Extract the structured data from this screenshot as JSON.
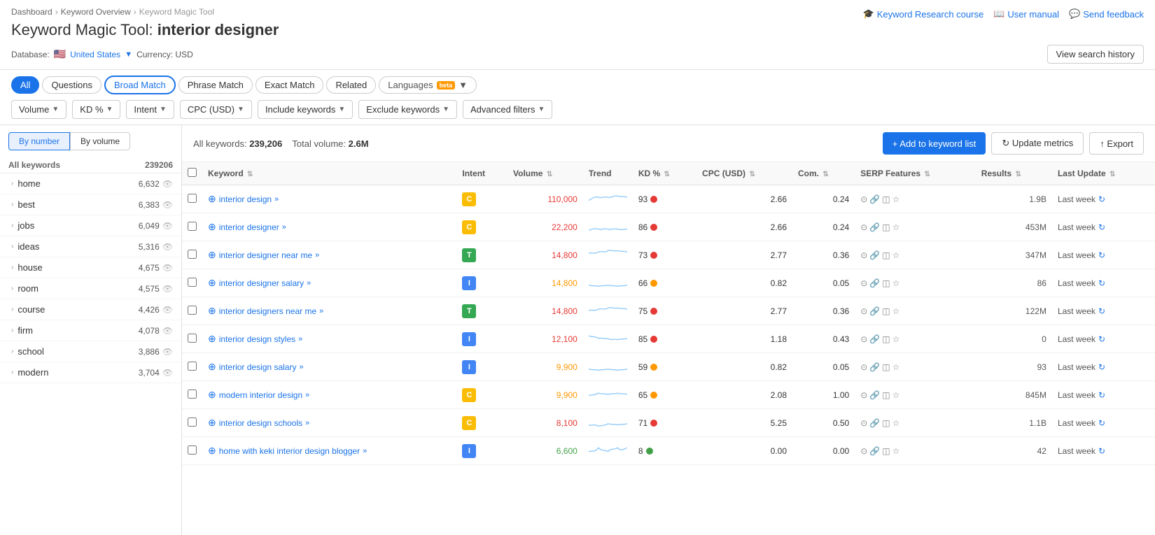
{
  "app": {
    "breadcrumb": [
      "Dashboard",
      "Keyword Overview",
      "Keyword Magic Tool"
    ],
    "title_prefix": "Keyword Magic Tool:",
    "title_keyword": "interior designer",
    "db_label": "Database:",
    "db_country": "United States",
    "currency_label": "Currency: USD"
  },
  "top_links": [
    {
      "label": "Keyword Research course",
      "icon": "graduation-icon"
    },
    {
      "label": "User manual",
      "icon": "book-icon"
    },
    {
      "label": "Send feedback",
      "icon": "feedback-icon"
    }
  ],
  "view_history_btn": "View search history",
  "tabs": [
    {
      "label": "All",
      "active": true,
      "outline": false
    },
    {
      "label": "Questions",
      "active": false,
      "outline": false
    },
    {
      "label": "Broad Match",
      "active": false,
      "outline": true
    },
    {
      "label": "Phrase Match",
      "active": false,
      "outline": false
    },
    {
      "label": "Exact Match",
      "active": false,
      "outline": false
    },
    {
      "label": "Related",
      "active": false,
      "outline": false
    }
  ],
  "languages_btn": "Languages",
  "beta": "beta",
  "filters": [
    {
      "label": "Volume"
    },
    {
      "label": "KD %"
    },
    {
      "label": "Intent"
    },
    {
      "label": "CPC (USD)"
    },
    {
      "label": "Include keywords"
    },
    {
      "label": "Exclude keywords"
    },
    {
      "label": "Advanced filters"
    }
  ],
  "sort_buttons": [
    "By number",
    "By volume"
  ],
  "active_sort": 0,
  "sidebar_header": {
    "label": "All keywords",
    "count": 239206
  },
  "sidebar_items": [
    {
      "label": "home",
      "count": "6,632"
    },
    {
      "label": "best",
      "count": "6,383"
    },
    {
      "label": "jobs",
      "count": "6,049"
    },
    {
      "label": "ideas",
      "count": "5,316"
    },
    {
      "label": "house",
      "count": "4,675"
    },
    {
      "label": "room",
      "count": "4,575"
    },
    {
      "label": "course",
      "count": "4,426"
    },
    {
      "label": "firm",
      "count": "4,078"
    },
    {
      "label": "school",
      "count": "3,886"
    },
    {
      "label": "modern",
      "count": "3,704"
    }
  ],
  "results": {
    "all_keywords_label": "All keywords:",
    "all_keywords_count": "239,206",
    "total_volume_label": "Total volume:",
    "total_volume_value": "2.6M",
    "add_btn": "+ Add to keyword list",
    "update_btn": "↻ Update metrics",
    "export_btn": "↑ Export"
  },
  "table_headers": [
    {
      "label": "Keyword",
      "sortable": true
    },
    {
      "label": "Intent",
      "sortable": false
    },
    {
      "label": "Volume",
      "sortable": true
    },
    {
      "label": "Trend",
      "sortable": false
    },
    {
      "label": "KD %",
      "sortable": true
    },
    {
      "label": "CPC (USD)",
      "sortable": true
    },
    {
      "label": "Com.",
      "sortable": true
    },
    {
      "label": "SERP Features",
      "sortable": true
    },
    {
      "label": "Results",
      "sortable": true
    },
    {
      "label": "Last Update",
      "sortable": true
    }
  ],
  "rows": [
    {
      "keyword": "interior design",
      "intent": "C",
      "intent_class": "intent-c",
      "volume": "110,000",
      "volume_color": "#e53935",
      "kd": 93,
      "kd_class": "dot-red",
      "cpc": "2.66",
      "com": "0.24",
      "results": "1.9B",
      "update": "Last week"
    },
    {
      "keyword": "interior designer",
      "intent": "C",
      "intent_class": "intent-c",
      "volume": "22,200",
      "volume_color": "#e53935",
      "kd": 86,
      "kd_class": "dot-red",
      "cpc": "2.66",
      "com": "0.24",
      "results": "453M",
      "update": "Last week"
    },
    {
      "keyword": "interior designer near me",
      "intent": "T",
      "intent_class": "intent-t",
      "volume": "14,800",
      "volume_color": "#e53935",
      "kd": 73,
      "kd_class": "dot-red",
      "cpc": "2.77",
      "com": "0.36",
      "results": "347M",
      "update": "Last week"
    },
    {
      "keyword": "interior designer salary",
      "intent": "I",
      "intent_class": "intent-i",
      "volume": "14,800",
      "volume_color": "#ff9800",
      "kd": 66,
      "kd_class": "dot-orange",
      "cpc": "0.82",
      "com": "0.05",
      "results": "86",
      "update": "Last week"
    },
    {
      "keyword": "interior designers near me",
      "intent": "T",
      "intent_class": "intent-t",
      "volume": "14,800",
      "volume_color": "#e53935",
      "kd": 75,
      "kd_class": "dot-red",
      "cpc": "2.77",
      "com": "0.36",
      "results": "122M",
      "update": "Last week"
    },
    {
      "keyword": "interior design styles",
      "intent": "I",
      "intent_class": "intent-i",
      "volume": "12,100",
      "volume_color": "#e53935",
      "kd": 85,
      "kd_class": "dot-red",
      "cpc": "1.18",
      "com": "0.43",
      "results": "0",
      "update": "Last week"
    },
    {
      "keyword": "interior design salary",
      "intent": "I",
      "intent_class": "intent-i",
      "volume": "9,900",
      "volume_color": "#ff9800",
      "kd": 59,
      "kd_class": "dot-orange",
      "cpc": "0.82",
      "com": "0.05",
      "results": "93",
      "update": "Last week"
    },
    {
      "keyword": "modern interior design",
      "intent": "C",
      "intent_class": "intent-c",
      "volume": "9,900",
      "volume_color": "#ff9800",
      "kd": 65,
      "kd_class": "dot-orange",
      "cpc": "2.08",
      "com": "1.00",
      "results": "845M",
      "update": "Last week"
    },
    {
      "keyword": "interior design schools",
      "intent": "C",
      "intent_class": "intent-c",
      "volume": "8,100",
      "volume_color": "#e53935",
      "kd": 71,
      "kd_class": "dot-red",
      "cpc": "5.25",
      "com": "0.50",
      "results": "1.1B",
      "update": "Last week"
    },
    {
      "keyword": "home with keki interior design blogger",
      "intent": "I",
      "intent_class": "intent-i",
      "volume": "6,600",
      "volume_color": "#43a047",
      "kd": 8,
      "kd_class": "dot-green",
      "cpc": "0.00",
      "com": "0.00",
      "results": "42",
      "update": "Last week"
    }
  ],
  "sparklines": [
    "M0,15 C5,12 10,8 15,10 C20,12 25,8 30,10 C35,12 40,6 45,8 C50,10 55,8 60,10",
    "M0,18 C5,16 10,14 15,16 C20,18 25,14 30,16 C35,18 40,14 45,16 C50,18 55,16 60,16",
    "M0,10 C5,8 10,12 15,8 C20,6 25,10 30,6 C35,4 40,8 45,6 C50,8 55,6 60,8",
    "M0,16 C5,18 10,16 15,18 C20,16 25,18 30,16 C35,18 40,16 45,18 C50,16 55,18 60,16",
    "M0,12 C5,10 10,14 15,10 C20,8 25,12 30,8 C35,6 40,10 45,8 C50,10 55,8 60,10",
    "M0,8 C5,10 10,8 15,12 C20,10 25,14 30,12 C35,16 40,12 45,14 C50,12 55,14 60,12",
    "M0,16 C5,18 10,16 15,18 C20,16 25,18 30,16 C35,18 40,16 45,18 C50,16 55,18 60,16",
    "M0,14 C5,12 10,14 15,10 C20,12 25,10 30,12 C35,10 40,12 45,10 C50,12 55,10 60,12",
    "M0,16 C5,18 10,14 15,18 C20,16 25,18 30,14 C35,16 40,14 45,16 C50,14 55,16 60,14",
    "M0,14 C5,12 10,16 15,8 C20,14 25,10 30,14 C35,8 40,12 45,8 C50,14 55,10 60,8"
  ]
}
